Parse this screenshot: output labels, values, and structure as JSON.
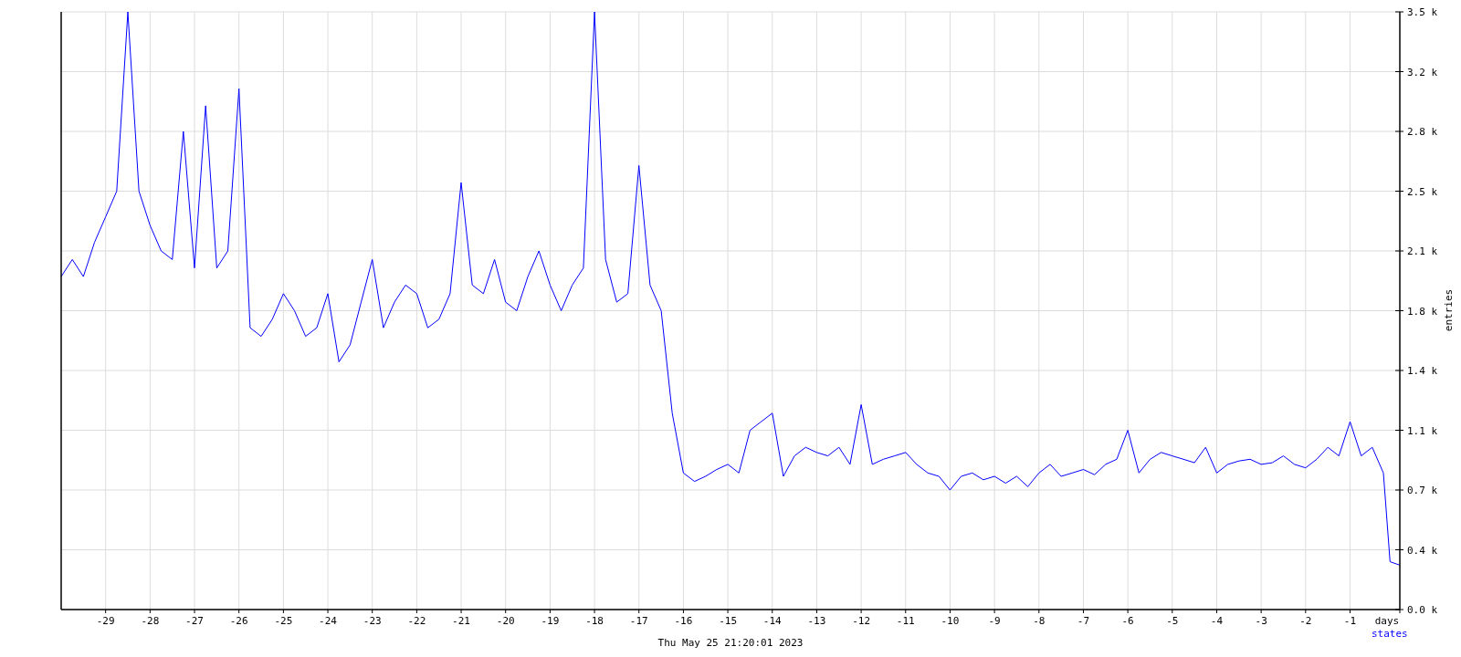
{
  "graph": {
    "timestamp": "Thu May 25 21:20:01 2023",
    "chart_data": {
      "type": "line",
      "xlabel": "days",
      "ylabel": "entries",
      "xlim": [
        -30,
        0.12
      ],
      "ylim": [
        0,
        3500
      ],
      "grid": true,
      "xticks": [
        -29,
        -28,
        -27,
        -26,
        -25,
        -24,
        -23,
        -22,
        -21,
        -20,
        -19,
        -18,
        -17,
        -16,
        -15,
        -14,
        -13,
        -12,
        -11,
        -10,
        -9,
        -8,
        -7,
        -6,
        -5,
        -4,
        -3,
        -2,
        -1
      ],
      "yticks": [
        {
          "value": 0,
          "label": "0.0 k"
        },
        {
          "value": 350,
          "label": "0.4 k"
        },
        {
          "value": 700,
          "label": "0.7 k"
        },
        {
          "value": 1050,
          "label": "1.1 k"
        },
        {
          "value": 1400,
          "label": "1.4 k"
        },
        {
          "value": 1750,
          "label": "1.8 k"
        },
        {
          "value": 2100,
          "label": "2.1 k"
        },
        {
          "value": 2450,
          "label": "2.5 k"
        },
        {
          "value": 2800,
          "label": "2.8 k"
        },
        {
          "value": 3150,
          "label": "3.2 k"
        },
        {
          "value": 3500,
          "label": "3.5 k"
        }
      ],
      "x": [
        -30,
        -29.75,
        -29.5,
        -29.25,
        -29,
        -28.75,
        -28.5,
        -28.25,
        -28,
        -27.75,
        -27.5,
        -27.25,
        -27,
        -26.75,
        -26.5,
        -26.25,
        -26,
        -25.75,
        -25.5,
        -25.25,
        -25,
        -24.75,
        -24.5,
        -24.25,
        -24,
        -23.75,
        -23.5,
        -23.25,
        -23,
        -22.75,
        -22.5,
        -22.25,
        -22,
        -21.75,
        -21.5,
        -21.25,
        -21,
        -20.75,
        -20.5,
        -20.25,
        -20,
        -19.75,
        -19.5,
        -19.25,
        -19,
        -18.75,
        -18.5,
        -18.25,
        -18,
        -17.75,
        -17.5,
        -17.25,
        -17,
        -16.75,
        -16.5,
        -16.25,
        -16,
        -15.75,
        -15.5,
        -15.25,
        -15,
        -14.75,
        -14.5,
        -14.25,
        -14,
        -13.75,
        -13.5,
        -13.25,
        -13,
        -12.75,
        -12.5,
        -12.25,
        -12,
        -11.75,
        -11.5,
        -11.25,
        -11,
        -10.75,
        -10.5,
        -10.25,
        -10,
        -9.75,
        -9.5,
        -9.25,
        -9,
        -8.75,
        -8.5,
        -8.25,
        -8,
        -7.75,
        -7.5,
        -7.25,
        -7,
        -6.75,
        -6.5,
        -6.25,
        -6,
        -5.75,
        -5.5,
        -5.25,
        -5,
        -4.75,
        -4.5,
        -4.25,
        -4,
        -3.75,
        -3.5,
        -3.25,
        -3,
        -2.75,
        -2.5,
        -2.25,
        -2,
        -1.75,
        -1.5,
        -1.25,
        -1,
        -0.75,
        -0.5,
        -0.25,
        -0.1,
        0.12
      ],
      "series": [
        {
          "name": "states",
          "color": "#0000ff",
          "values": [
            1950,
            2050,
            1950,
            2150,
            2300,
            2450,
            3500,
            2450,
            2250,
            2100,
            2050,
            2800,
            2000,
            2950,
            2000,
            2100,
            3050,
            1650,
            1600,
            1700,
            1850,
            1750,
            1600,
            1650,
            1850,
            1450,
            1550,
            1800,
            2050,
            1650,
            1800,
            1900,
            1850,
            1650,
            1700,
            1850,
            2500,
            1900,
            1850,
            2050,
            1800,
            1750,
            1950,
            2100,
            1900,
            1750,
            1900,
            2000,
            3500,
            2050,
            1800,
            1850,
            2600,
            1900,
            1750,
            1150,
            800,
            750,
            780,
            820,
            850,
            800,
            1050,
            1100,
            1150,
            780,
            900,
            950,
            920,
            900,
            950,
            850,
            1200,
            850,
            880,
            900,
            920,
            850,
            800,
            780,
            700,
            780,
            800,
            760,
            780,
            740,
            780,
            720,
            800,
            850,
            780,
            800,
            820,
            790,
            850,
            880,
            1050,
            800,
            880,
            920,
            900,
            880,
            860,
            950,
            800,
            850,
            870,
            880,
            850,
            860,
            900,
            850,
            830,
            880,
            950,
            900,
            1100,
            900,
            950,
            800,
            280,
            260
          ]
        }
      ]
    }
  }
}
